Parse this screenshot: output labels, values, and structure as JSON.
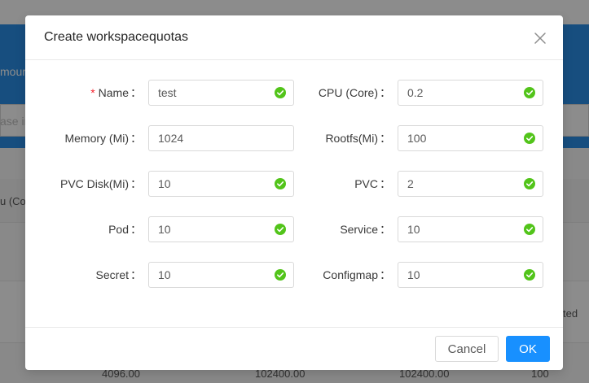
{
  "background": {
    "partial_label_top": "mour",
    "search_placeholder_partial": "ase in",
    "column_header_partial": "u (Co",
    "row_status_partial": "ted",
    "bottom_row_values": [
      "4096.00",
      "102400.00",
      "102400.00",
      "100"
    ]
  },
  "modal": {
    "title": "Create workspacequotas",
    "fields": [
      {
        "label": "Name",
        "required": true,
        "value": "test",
        "valid": true
      },
      {
        "label": "CPU (Core)",
        "required": false,
        "value": "0.2",
        "valid": true
      },
      {
        "label": "Memory (Mi)",
        "required": false,
        "value": "1024",
        "valid": false
      },
      {
        "label": "Rootfs(Mi)",
        "required": false,
        "value": "100",
        "valid": true
      },
      {
        "label": "PVC Disk(Mi)",
        "required": false,
        "value": "10",
        "valid": true
      },
      {
        "label": "PVC",
        "required": false,
        "value": "2",
        "valid": true
      },
      {
        "label": "Pod",
        "required": false,
        "value": "10",
        "valid": true
      },
      {
        "label": "Service",
        "required": false,
        "value": "10",
        "valid": true
      },
      {
        "label": "Secret",
        "required": false,
        "value": "10",
        "valid": true
      },
      {
        "label": "Configmap",
        "required": false,
        "value": "10",
        "valid": true
      }
    ],
    "colon": "：",
    "required_mark": "*",
    "cancel_label": "Cancel",
    "ok_label": "OK"
  },
  "colors": {
    "primary": "#1890ff",
    "success": "#52c41a",
    "required": "#f5222d",
    "header_blue": "#2a8ee8"
  },
  "icons": {
    "close": "close-icon",
    "valid": "check-circle-icon"
  }
}
